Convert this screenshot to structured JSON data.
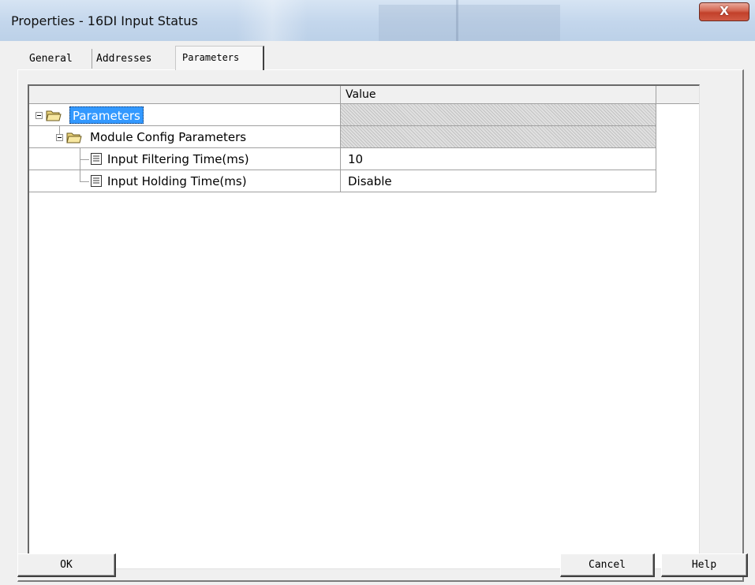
{
  "window": {
    "title": "Properties - 16DI Input Status",
    "close_glyph": "X"
  },
  "tabs": [
    {
      "label": "General"
    },
    {
      "label": "Addresses"
    },
    {
      "label": "Parameters",
      "active": true
    }
  ],
  "grid": {
    "columns": {
      "name": "",
      "value": "Value"
    },
    "rows": [
      {
        "label": "Parameters",
        "value": "",
        "type": "folder",
        "selected": true
      },
      {
        "label": "Module Config Parameters",
        "value": "",
        "type": "folder"
      },
      {
        "label": "Input Filtering Time(ms)",
        "value": "10",
        "type": "parameter"
      },
      {
        "label": "Input Holding Time(ms)",
        "value": "Disable",
        "type": "parameter"
      }
    ]
  },
  "buttons": {
    "ok": "OK",
    "cancel": "Cancel",
    "help": "Help"
  },
  "colors": {
    "selection": "#3399ff",
    "close_button": "#c2402a"
  }
}
